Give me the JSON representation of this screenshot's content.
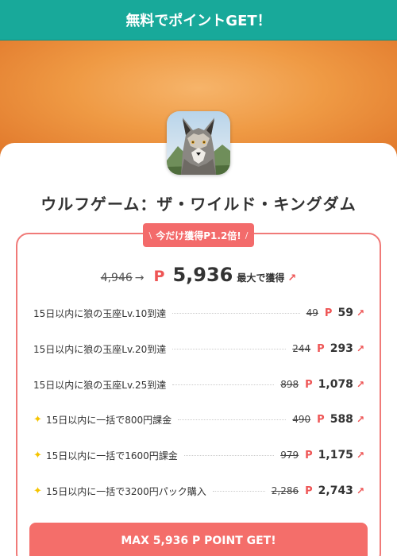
{
  "banner": {
    "text": "無料でポイントGET！"
  },
  "app": {
    "title": "ウルフゲーム：ザ・ワイルド・キングダム",
    "icon": "wolf-app-icon"
  },
  "promo": {
    "text": "今だけ獲得P1.2倍!",
    "slash_left": "\\",
    "slash_right": "/"
  },
  "total": {
    "old": "4,946",
    "arrow": "→",
    "p_mark": "P",
    "points": "5,936",
    "max_label": "最大で獲得",
    "up": "↗"
  },
  "tasks": [
    {
      "label": "15日以内に狼の玉座Lv.10到達",
      "old": "49",
      "p": "P",
      "points": "59",
      "up": "↗",
      "star": ""
    },
    {
      "label": "15日以内に狼の玉座Lv.20到達",
      "old": "244",
      "p": "P",
      "points": "293",
      "up": "↗",
      "star": ""
    },
    {
      "label": "15日以内に狼の玉座Lv.25到達",
      "old": "898",
      "p": "P",
      "points": "1,078",
      "up": "↗",
      "star": ""
    },
    {
      "label": "15日以内に一括で800円課金",
      "old": "490",
      "p": "P",
      "points": "588",
      "up": "↗",
      "star": "✦"
    },
    {
      "label": "15日以内に一括で1600円課金",
      "old": "979",
      "p": "P",
      "points": "1,175",
      "up": "↗",
      "star": "✦"
    },
    {
      "label": "15日以内に一括で3200円パック購入",
      "old": "2,286",
      "p": "P",
      "points": "2,743",
      "up": "↗",
      "star": "✦"
    }
  ],
  "cta": {
    "label": "MAX 5,936 P POINT GET!"
  },
  "colors": {
    "banner": "#18a99a",
    "accent": "#f36b6b",
    "hero": "#e0762a",
    "star": "#f5c400"
  }
}
